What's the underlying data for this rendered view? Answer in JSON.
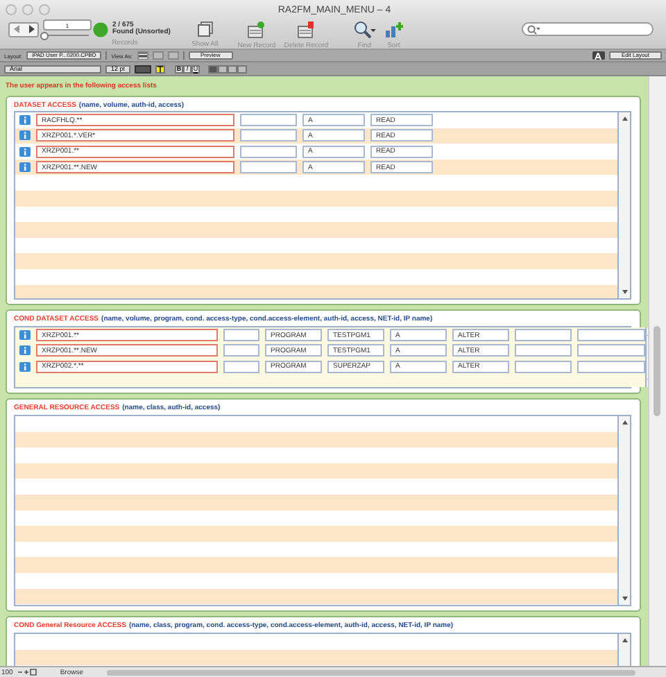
{
  "window": {
    "title": "RA2FM_MAIN_MENU – 4"
  },
  "toolbar": {
    "record_value": "1",
    "record_count": "2 / 675",
    "found_status": "Found (Unsorted)",
    "records_label": "Records",
    "record_slider": {
      "level": 0.003
    },
    "buttons": [
      {
        "kind": "show-all",
        "label": "Show All"
      },
      {
        "kind": "new-record",
        "label": "New Record"
      },
      {
        "kind": "delete-record",
        "label": "Delete Record"
      },
      {
        "kind": "find",
        "label": "Find"
      },
      {
        "kind": "sort",
        "label": "Sort"
      }
    ]
  },
  "layout_bar": {
    "layout_label": "Layout:",
    "layout_value": "iPAD User P...0200.CPBD",
    "view_as_label": "View As:",
    "preview": "Preview",
    "edit_layout": "Edit Layout"
  },
  "format_bar": {
    "font": "Arial",
    "size": "12 pt",
    "styles": [
      "B",
      "I",
      "U"
    ]
  },
  "content": {
    "intro": "The user appears in the following access lists",
    "sections": [
      {
        "title": "DATASET ACCESS",
        "fields": "(name, volume, auth-id, access)",
        "rows": [
          {
            "cells": [
              {
                "kind": "name",
                "value": "RACFHLQ.**"
              },
              {
                "kind": "blank"
              },
              {
                "kind": "text",
                "value": "A"
              },
              {
                "kind": "text",
                "value": "READ"
              }
            ]
          },
          {
            "cells": [
              {
                "kind": "name",
                "value": "XRZP001.*.VER*"
              },
              {
                "kind": "blank"
              },
              {
                "kind": "text",
                "value": "A"
              },
              {
                "kind": "text",
                "value": "READ"
              }
            ]
          },
          {
            "cells": [
              {
                "kind": "name",
                "value": "XRZP001.**"
              },
              {
                "kind": "blank"
              },
              {
                "kind": "text",
                "value": "A"
              },
              {
                "kind": "text",
                "value": "READ"
              }
            ]
          },
          {
            "cells": [
              {
                "kind": "name",
                "value": "XRZP001.**.NEW"
              },
              {
                "kind": "blank"
              },
              {
                "kind": "text",
                "value": "A"
              },
              {
                "kind": "text",
                "value": "READ"
              }
            ]
          }
        ]
      },
      {
        "title": "COND DATASET ACCESS",
        "fields": "(name, volume, program, cond. access-type, cond.access-element, auth-id, access, NET-id, IP name)",
        "rows": [
          {
            "cells": [
              {
                "kind": "name",
                "value": "XRZP001.**"
              },
              {
                "kind": "blank"
              },
              {
                "kind": "text",
                "value": "PROGRAM"
              },
              {
                "kind": "text",
                "value": "TESTPGM1"
              },
              {
                "kind": "text",
                "value": "A"
              },
              {
                "kind": "text",
                "value": "ALTER"
              },
              {
                "kind": "blank"
              },
              {
                "kind": "blank"
              }
            ]
          },
          {
            "cells": [
              {
                "kind": "name",
                "value": "XRZP001.**.NEW"
              },
              {
                "kind": "blank"
              },
              {
                "kind": "text",
                "value": "PROGRAM"
              },
              {
                "kind": "text",
                "value": "TESTPGM1"
              },
              {
                "kind": "text",
                "value": "A"
              },
              {
                "kind": "text",
                "value": "ALTER"
              },
              {
                "kind": "blank"
              },
              {
                "kind": "blank"
              }
            ]
          },
          {
            "cells": [
              {
                "kind": "name",
                "value": "XRZP002.*.**"
              },
              {
                "kind": "blank"
              },
              {
                "kind": "text",
                "value": "PROGRAM"
              },
              {
                "kind": "text",
                "value": "SUPERZAP"
              },
              {
                "kind": "text",
                "value": "A"
              },
              {
                "kind": "text",
                "value": "ALTER"
              },
              {
                "kind": "blank"
              },
              {
                "kind": "blank"
              }
            ]
          }
        ]
      },
      {
        "title": "GENERAL RESOURCE ACCESS",
        "fields": "(name, class, auth-id, access)"
      },
      {
        "title": "COND General Resource ACCESS",
        "fields": "(name, class, program, cond. access-type, cond.access-element, auth-id, access, NET-id, IP name)"
      }
    ]
  },
  "status_bar": {
    "zoom": "100",
    "mode": "Browse"
  }
}
